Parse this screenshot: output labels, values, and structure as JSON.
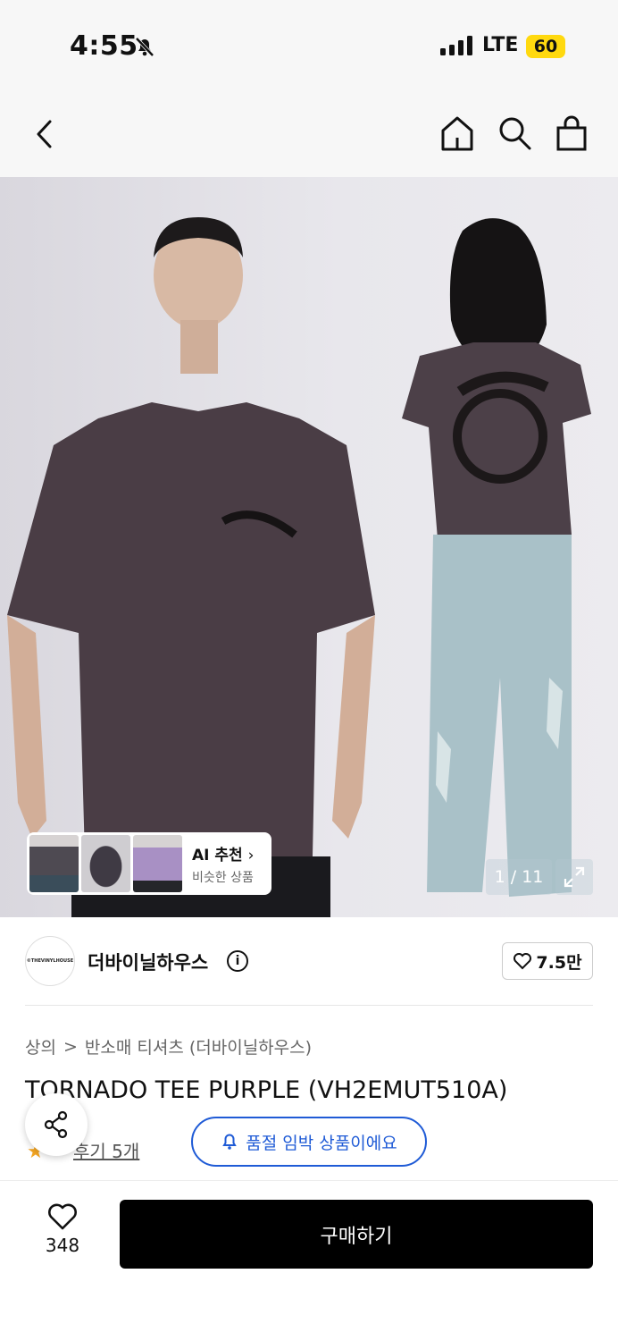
{
  "status_bar": {
    "time": "4:55",
    "network": "LTE",
    "battery": "60"
  },
  "icons": {
    "back": "chevron-left-icon",
    "home": "home-icon",
    "search": "search-icon",
    "bag": "shopping-bag-icon",
    "mute": "bell-slash-icon",
    "expand": "expand-icon",
    "share": "share-icon",
    "heart": "heart-icon",
    "bell": "bell-icon",
    "info": "info-icon"
  },
  "gallery": {
    "counter": "1 / 11",
    "ai": {
      "title": "AI 추천",
      "subtitle": "비슷한 상품"
    }
  },
  "brand": {
    "logo_text": "©THEVINYLHOUSE",
    "name": "더바이닐하우스",
    "likes": "7.5만"
  },
  "breadcrumb": {
    "category": "상의",
    "separator": ">",
    "subcategory": "반소매 티셔츠 (더바이닐하우스)"
  },
  "product": {
    "title": "TORNADO TEE PURPLE (VH2EMUT510A)",
    "reviews": "후기 5개"
  },
  "restock": {
    "label": "품절 임박 상품이에요"
  },
  "actions": {
    "wish_count": "348",
    "buy_label": "구매하기"
  },
  "colors": {
    "accent": "#1f5bd6",
    "buy_button": "#000000",
    "battery": "#ffd90f",
    "star": "#f5a623"
  }
}
